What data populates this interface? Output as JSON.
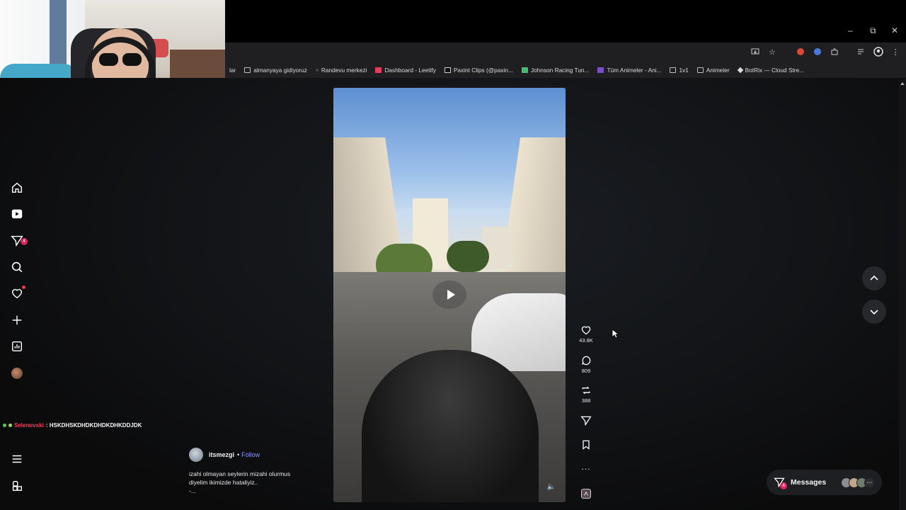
{
  "window_controls": {
    "minimize": "–",
    "restore": "⧉",
    "close": "✕"
  },
  "bookmarks": [
    {
      "label": "lar",
      "icon": "partial"
    },
    {
      "label": "almanyaya gidiyoruz",
      "icon": "folder-icon"
    },
    {
      "label": "Randevu merkezi",
      "icon": "site-icon"
    },
    {
      "label": "Dashboard - Leetify",
      "icon": "leetify-icon"
    },
    {
      "label": "Paxint Clips (@paxin...",
      "icon": "tiktok-icon"
    },
    {
      "label": "Johnson Racing Tun...",
      "icon": "site-icon"
    },
    {
      "label": "Tüm Animeler - Ani...",
      "icon": "site-icon"
    },
    {
      "label": "1v1",
      "icon": "folder-icon"
    },
    {
      "label": "Animeler",
      "icon": "folder-icon"
    },
    {
      "label": "BotRix — Cloud Stre...",
      "icon": "site-icon"
    }
  ],
  "sidebar": {
    "messages_badge": "4",
    "items": [
      "home-icon",
      "reels-icon",
      "messages-icon",
      "search-icon",
      "notifications-icon",
      "create-icon",
      "dashboard-icon",
      "profile-avatar",
      "menu-icon",
      "more-icon"
    ]
  },
  "chat": {
    "username": "Selenovski",
    "message": ": HSKDHSKDHDKDHDKDHKDDJDK"
  },
  "post": {
    "username": "itsmezgi",
    "separator": "•",
    "follow_label": "Follow",
    "caption_line1": "izahi olmayan seylerin mizahi olurmus",
    "caption_line2": "diyelim ikimizde hataliyiz..",
    "caption_more": "-..."
  },
  "actions": {
    "likes": "43.8K",
    "comments": "809",
    "reposts": "388",
    "more": "..."
  },
  "messages_pill": {
    "label": "Messages",
    "badge": "4",
    "overflow": "···"
  }
}
